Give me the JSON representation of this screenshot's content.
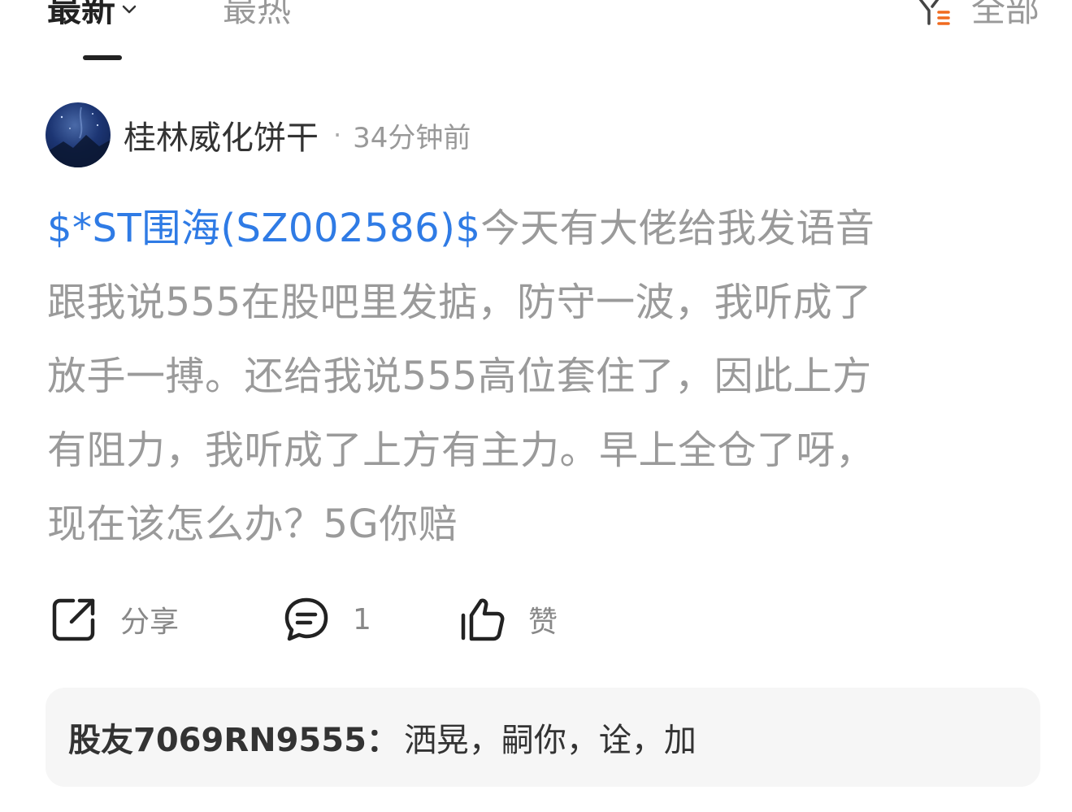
{
  "tabs": {
    "latest": "最新",
    "hot": "最热",
    "filter": "全部"
  },
  "post": {
    "username": "桂林威化饼干",
    "separator": "·",
    "time": "34分钟前",
    "stock_tag": "$*ST围海(SZ002586)$",
    "lines": [
      "今天有大佬给我发语音",
      "跟我说555在股吧里发掂，防守一波，我听成了",
      "放手一搏。还给我说555高位套住了，因此上方",
      "有阻力，我听成了上方有主力。早上全仓了呀，",
      "现在该怎么办？5G你赔"
    ]
  },
  "actions": {
    "share_label": "分享",
    "comment_count": "1",
    "like_label": "赞"
  },
  "comment_preview": {
    "author": "股友7069RN9555：",
    "text": "洒晃，嗣你，诠，加"
  },
  "colors": {
    "link": "#2f7be5",
    "filter_accent": "#f06a1f"
  }
}
